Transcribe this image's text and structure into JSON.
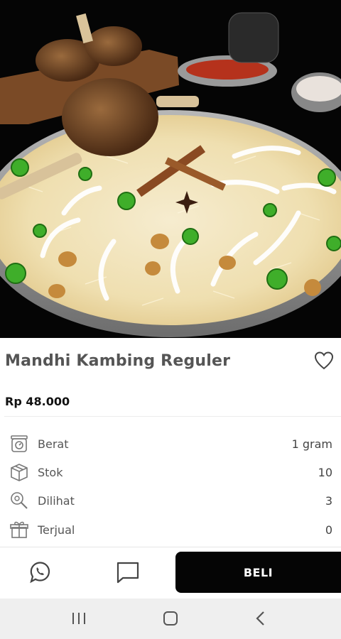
{
  "product": {
    "image_alt": "Mandhi Kambing plated with lamb shank on rice",
    "title": "Mandhi Kambing Reguler",
    "price": "Rp 48.000",
    "favorite_icon": "heart-outline-icon"
  },
  "specs": [
    {
      "label": "Berat",
      "value": "1 gram",
      "icon": "scale-icon"
    },
    {
      "label": "Stok",
      "value": "10",
      "icon": "box-icon"
    },
    {
      "label": "Dilihat",
      "value": "3",
      "icon": "view-search-icon"
    },
    {
      "label": "Terjual",
      "value": "0",
      "icon": "sold-package-icon"
    }
  ],
  "actions": {
    "whatsapp_icon": "whatsapp-icon",
    "chat_icon": "chat-icon",
    "buy_label": "BELI"
  },
  "system_nav": {
    "recent_icon": "recent-apps-icon",
    "home_icon": "home-icon",
    "back_icon": "back-icon"
  },
  "colors": {
    "buy_button": "#050505",
    "title_text": "#555555",
    "price_text": "#111111"
  }
}
